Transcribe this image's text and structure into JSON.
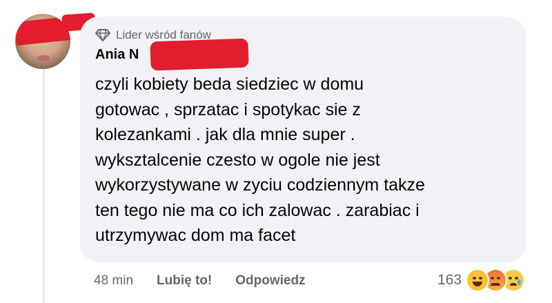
{
  "comment": {
    "badge": {
      "icon": "diamond-icon",
      "label": "Lider wśród fanów"
    },
    "author_visible": "Ania N",
    "text": "czyli kobiety beda siedziec w domu\ngotowac , sprzatac i spotykac sie z\nkolezankami . jak dla mnie super .\nwyksztalcenie czesto w ogole nie jest\nwykorzystywane w zyciu codziennym takze\nten tego nie ma co ich zalowac . zarabiac i\nutrzymywac dom  ma facet",
    "footer": {
      "time": "48 min",
      "like_label": "Lubię to!",
      "reply_label": "Odpowiedz"
    },
    "reactions": {
      "count": "163",
      "types": [
        "haha-emoji-icon",
        "angry-emoji-icon",
        "sad-emoji-icon"
      ]
    }
  },
  "colors": {
    "bubble_bg": "#f0f2f5",
    "text": "#050505",
    "secondary_text": "#65676b",
    "redaction": "#e21d2d"
  }
}
